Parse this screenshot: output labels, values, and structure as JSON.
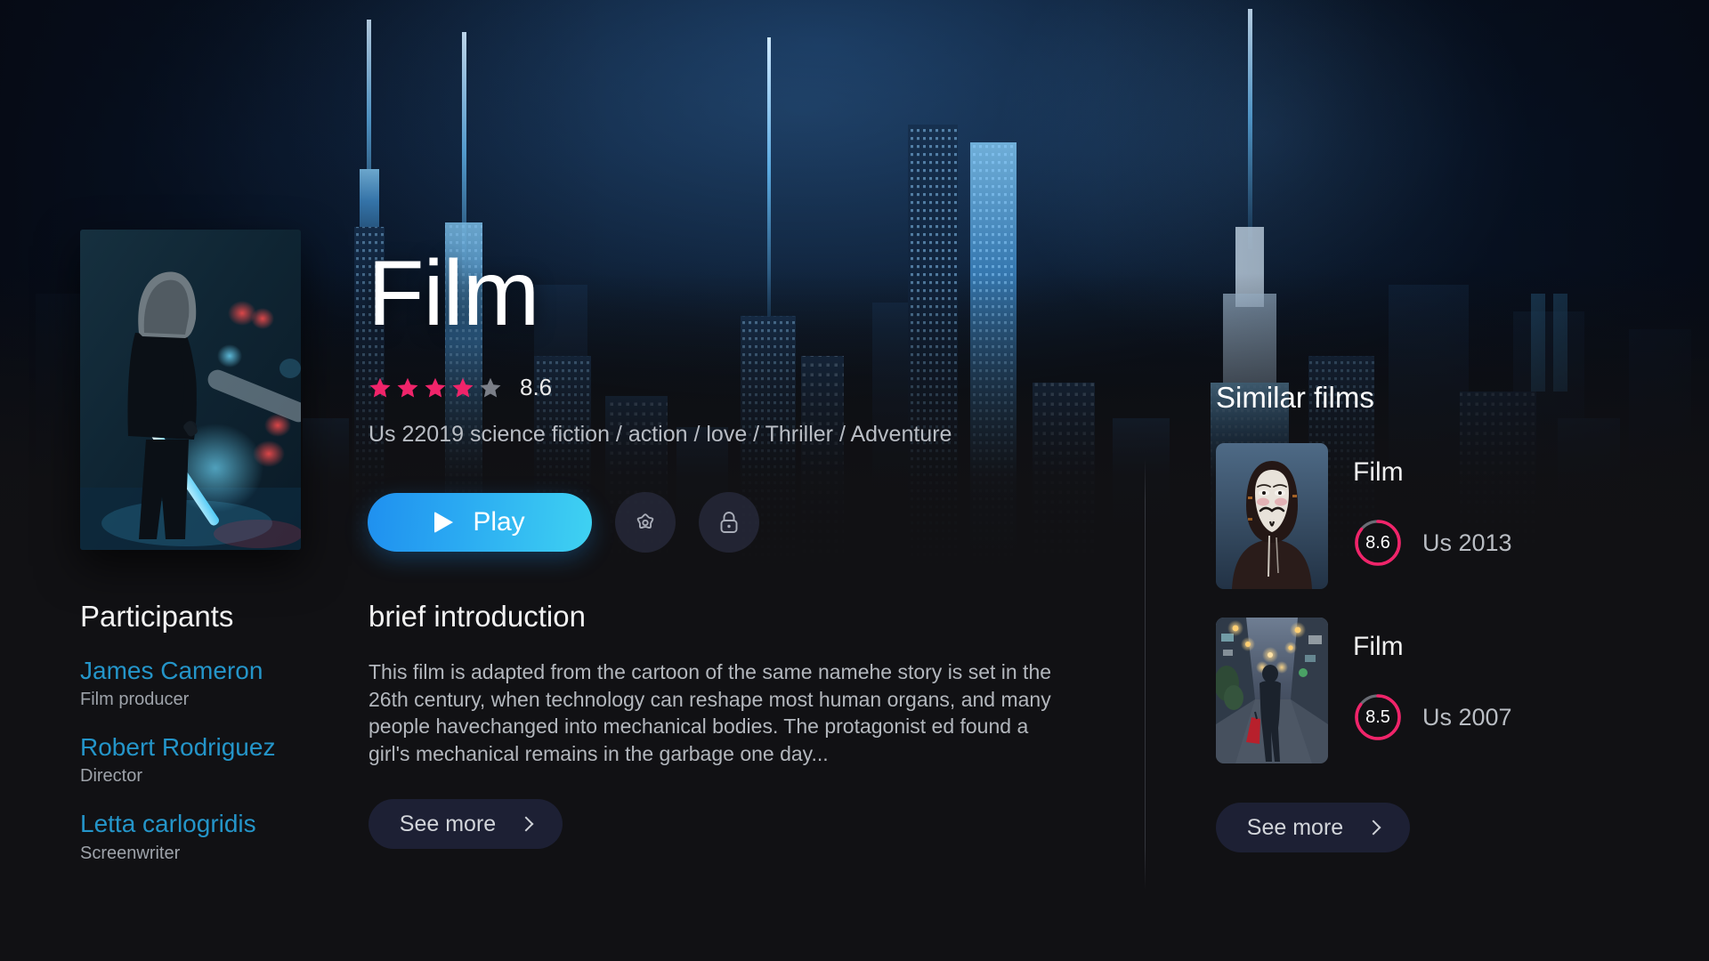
{
  "hero": {
    "poster_alt": "hooded-figure-with-lightsaber-poster",
    "title": "Film",
    "rating_value": "8.6",
    "stars_filled": 4,
    "stars_total": 5,
    "meta": "Us 22019 science fiction / action / love / Thriller / Adventure"
  },
  "actions": {
    "play_label": "Play",
    "favorite_icon": "star-outline-icon",
    "lock_icon": "lock-icon"
  },
  "participants": {
    "heading": "Participants",
    "people": [
      {
        "name": "James Cameron",
        "role": "Film producer"
      },
      {
        "name": "Robert Rodriguez",
        "role": "Director"
      },
      {
        "name": "Letta carlogridis",
        "role": "Screenwriter"
      }
    ]
  },
  "intro": {
    "heading": "brief introduction",
    "body": "This film is adapted from the cartoon of the same namehe story is set in the 26th century, when technology can reshape most human organs, and many people havechanged into mechanical bodies. The protagonist ed found a girl's mechanical remains in the garbage one day...",
    "see_more_label": "See more"
  },
  "similar": {
    "heading": "Similar films",
    "see_more_label": "See more",
    "items": [
      {
        "title": "Film",
        "score": "8.6",
        "score_pct": 86,
        "year": "Us 2013",
        "thumb_alt": "anonymous-mask-portrait"
      },
      {
        "title": "Film",
        "score": "8.5",
        "score_pct": 85,
        "year": "Us 2007",
        "thumb_alt": "person-walking-lit-alley"
      }
    ]
  },
  "colors": {
    "accent_pink": "#f0246a",
    "accent_blue_start": "#1f90ef",
    "accent_blue_end": "#3fd2f2",
    "link_teal": "#2495c9",
    "star_empty": "#7b7f88",
    "background": "#111114",
    "pill_bg": "#1d2034"
  }
}
